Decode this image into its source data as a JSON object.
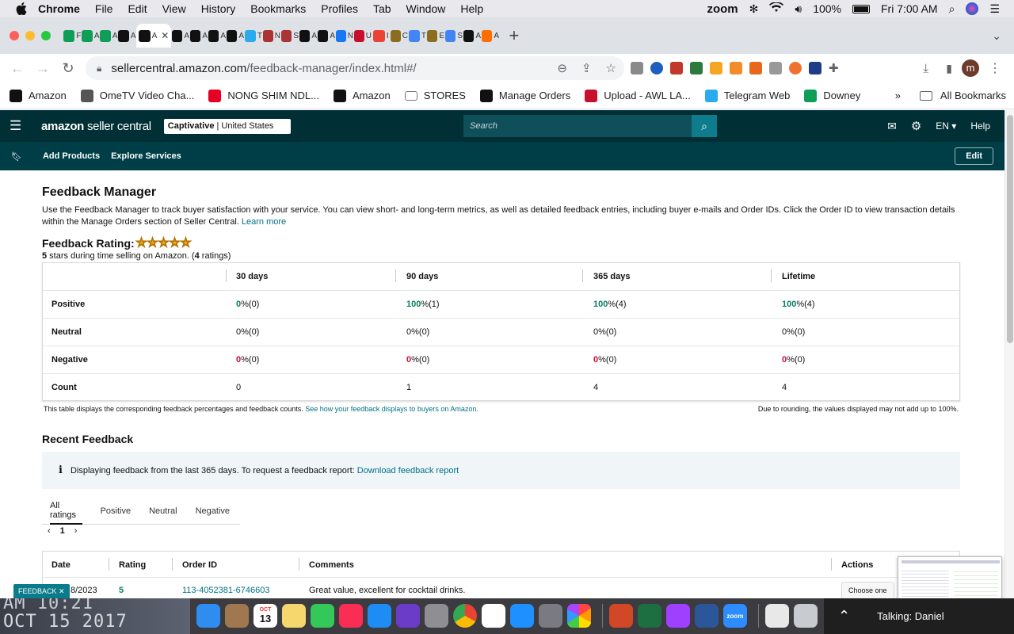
{
  "menubar": {
    "app": "Chrome",
    "items": [
      "File",
      "Edit",
      "View",
      "History",
      "Bookmarks",
      "Profiles",
      "Tab",
      "Window",
      "Help"
    ],
    "battery": "100%",
    "clock": "Fri 7:00 AM",
    "zoom_label": "zoom"
  },
  "browser": {
    "url_host": "sellercentral.amazon.com",
    "url_path": "/feedback-manager/index.html#/",
    "profile_initial": "m",
    "tabs": [
      {
        "label": "F",
        "color": "#0f9d58"
      },
      {
        "label": "A",
        "color": "#0f9d58"
      },
      {
        "label": "A",
        "color": "#0f9d58"
      },
      {
        "label": "A",
        "color": "#111111"
      },
      {
        "label": "A",
        "color": "#111111",
        "active": true
      },
      {
        "label": "A",
        "color": "#111111"
      },
      {
        "label": "A",
        "color": "#111111"
      },
      {
        "label": "A",
        "color": "#111111"
      },
      {
        "label": "A",
        "color": "#111111"
      },
      {
        "label": "T",
        "color": "#2aabee"
      },
      {
        "label": "N",
        "color": "#aa3333"
      },
      {
        "label": "S",
        "color": "#aa3333"
      },
      {
        "label": "A",
        "color": "#111111"
      },
      {
        "label": "A",
        "color": "#111111"
      },
      {
        "label": "N",
        "color": "#1877f2"
      },
      {
        "label": "U",
        "color": "#c8102e"
      },
      {
        "label": "I",
        "color": "#ea4335"
      },
      {
        "label": "C",
        "color": "#8a6d1f"
      },
      {
        "label": "T",
        "color": "#4285f4"
      },
      {
        "label": "E",
        "color": "#8a6d1f"
      },
      {
        "label": "S",
        "color": "#4285f4"
      },
      {
        "label": "A",
        "color": "#111111"
      },
      {
        "label": "A",
        "color": "#ff6f00"
      }
    ]
  },
  "bookmarks": [
    {
      "label": "Amazon",
      "icon": "amazon-icon",
      "color": "#111111"
    },
    {
      "label": "OmeTV Video Cha...",
      "icon": "globe-icon",
      "color": "#555555"
    },
    {
      "label": "NONG SHIM NDL...",
      "icon": "pinterest-icon",
      "color": "#e60023"
    },
    {
      "label": "Amazon",
      "icon": "amazon-icon",
      "color": "#111111"
    },
    {
      "label": "STORES",
      "icon": "folder-icon",
      "color": "#777777"
    },
    {
      "label": "Manage Orders",
      "icon": "amazon-icon",
      "color": "#111111"
    },
    {
      "label": "Upload - AWL LA...",
      "icon": "upload-icon",
      "color": "#c8102e"
    },
    {
      "label": "Telegram Web",
      "icon": "telegram-icon",
      "color": "#2aabee"
    },
    {
      "label": "Downey",
      "icon": "sheets-icon",
      "color": "#0f9d58"
    }
  ],
  "bookmarks_more": "»",
  "bookmarks_all": "All Bookmarks",
  "seller_central": {
    "logo": "amazon",
    "logo_sub": "seller central",
    "account_store": "Captivative",
    "account_region": "| United States",
    "search_placeholder": "Search",
    "language": "EN",
    "help": "Help",
    "nav_items": [
      "Add Products",
      "Explore Services"
    ],
    "edit": "Edit"
  },
  "page": {
    "title": "Feedback Manager",
    "description": "Use the Feedback Manager to track buyer satisfaction with your service. You can view short- and long-term metrics, as well as detailed feedback entries, including buyer e-mails and Order IDs. Click the Order ID to view transaction details within the Manage Orders section of Seller Central.",
    "learn_more": "Learn more",
    "rating_title": "Feedback Rating:",
    "rating_stars": 5,
    "rating_sub_a": "5",
    "rating_sub_b": " stars during time selling on Amazon. (",
    "rating_sub_c": "4",
    "rating_sub_d": " ratings)",
    "table": {
      "columns": [
        "30 days",
        "90 days",
        "365 days",
        "Lifetime"
      ],
      "rows": [
        {
          "label": "Positive",
          "cells": [
            {
              "v": "0",
              "u": " %(0)",
              "c": "green"
            },
            {
              "v": "100",
              "u": " %(1)",
              "c": "green"
            },
            {
              "v": "100",
              "u": " %(4)",
              "c": "green"
            },
            {
              "v": "100",
              "u": " %(4)",
              "c": "green"
            }
          ]
        },
        {
          "label": "Neutral",
          "cells": [
            {
              "v": "0",
              "u": " %(0)",
              "c": "bold"
            },
            {
              "v": "0",
              "u": " %(0)",
              "c": "bold"
            },
            {
              "v": "0",
              "u": " %(0)",
              "c": "bold"
            },
            {
              "v": "0",
              "u": " %(0)",
              "c": "bold"
            }
          ]
        },
        {
          "label": "Negative",
          "cells": [
            {
              "v": "0",
              "u": " %(0)",
              "c": "red"
            },
            {
              "v": "0",
              "u": " %(0)",
              "c": "red"
            },
            {
              "v": "0",
              "u": " %(0)",
              "c": "red"
            },
            {
              "v": "0",
              "u": " %(0)",
              "c": "red"
            }
          ]
        },
        {
          "label": "Count",
          "cells": [
            {
              "v": "0",
              "u": "",
              "c": ""
            },
            {
              "v": "1",
              "u": "",
              "c": ""
            },
            {
              "v": "4",
              "u": "",
              "c": ""
            },
            {
              "v": "4",
              "u": "",
              "c": ""
            }
          ]
        }
      ]
    },
    "table_note": "This table displays the corresponding feedback percentages and feedback counts.",
    "table_note_link": "See how your feedback displays to buyers on Amazon.",
    "rounding_note": "Due to rounding, the values displayed may not add up to 100%.",
    "recent_title": "Recent Feedback",
    "info_icon": "i",
    "info_text": "Displaying feedback from the last 365 days. To request a feedback report:",
    "info_link": "Download feedback report",
    "filter_tabs": [
      "All ratings",
      "Positive",
      "Neutral",
      "Negative"
    ],
    "page_number": "1",
    "recent_columns": [
      "Date",
      "Rating",
      "Order ID",
      "Comments",
      "Actions"
    ],
    "recent_rows": [
      {
        "date": "8/2023",
        "rating": "5",
        "order_id": "113-4052381-6746603",
        "comment": "Great value, excellent for cocktail drinks.",
        "action": "Choose one"
      }
    ],
    "feedback_tag": "FEEDBACK ✕"
  },
  "dock": {
    "wallpaper_line1": "AM 10:21",
    "wallpaper_line2": "OCT 15 2017",
    "calendar_month": "OCT",
    "calendar_day": "13",
    "zoom_app_label": "zoom",
    "talking": "Talking: Daniel",
    "apps": [
      {
        "name": "finder-icon",
        "color": "#2f8cf0"
      },
      {
        "name": "archive-icon",
        "color": "#a07850"
      },
      {
        "name": "calendar-icon",
        "color": "#ffffff"
      },
      {
        "name": "notes-icon",
        "color": "#f5d76e"
      },
      {
        "name": "facetime-icon",
        "color": "#34c759"
      },
      {
        "name": "music-icon",
        "color": "#fa2d55"
      },
      {
        "name": "appstore-icon",
        "color": "#1e8cf5"
      },
      {
        "name": "siri-icon",
        "color": "#6a3cc8"
      },
      {
        "name": "settings-icon",
        "color": "#8e8e93"
      },
      {
        "name": "chrome-icon",
        "color": "#ffffff"
      },
      {
        "name": "reminders-icon",
        "color": "#ffffff"
      },
      {
        "name": "safari-icon",
        "color": "#1e90ff"
      },
      {
        "name": "launchpad-icon",
        "color": "#7a7a82"
      },
      {
        "name": "photos-icon",
        "color": "#ffffff"
      },
      {
        "name": "powerpoint-icon",
        "color": "#d24726"
      },
      {
        "name": "excel-icon",
        "color": "#1d6f42"
      },
      {
        "name": "messenger-icon",
        "color": "#a040ff"
      },
      {
        "name": "word-icon",
        "color": "#2b579a"
      },
      {
        "name": "zoom-icon",
        "color": "#2d8cff"
      }
    ]
  }
}
